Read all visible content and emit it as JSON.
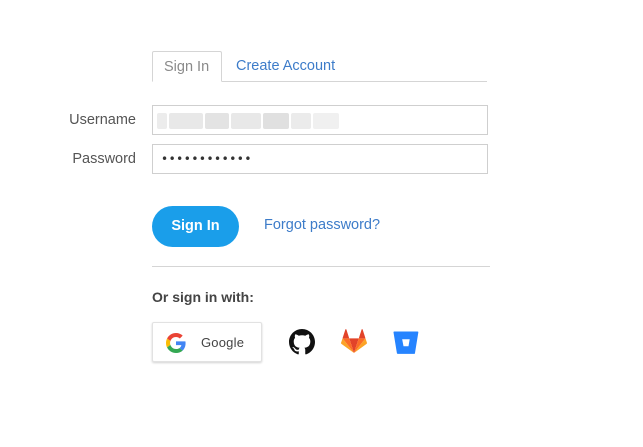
{
  "tabs": [
    {
      "label": "Sign In",
      "active": true
    },
    {
      "label": "Create Account",
      "active": false
    }
  ],
  "form": {
    "username_label": "Username",
    "username_value": "",
    "password_label": "Password",
    "password_value": "••••••••••••"
  },
  "actions": {
    "signin_label": "Sign In",
    "forgot_label": "Forgot password?"
  },
  "social": {
    "heading": "Or sign in with:",
    "google_label": "Google",
    "providers": [
      "google-icon",
      "github-icon",
      "gitlab-icon",
      "bitbucket-icon"
    ]
  },
  "colors": {
    "accent": "#1a9eea",
    "link": "#3d7cc9",
    "github": "#111111",
    "gitlab": "#e24329",
    "bitbucket": "#2684ff"
  }
}
